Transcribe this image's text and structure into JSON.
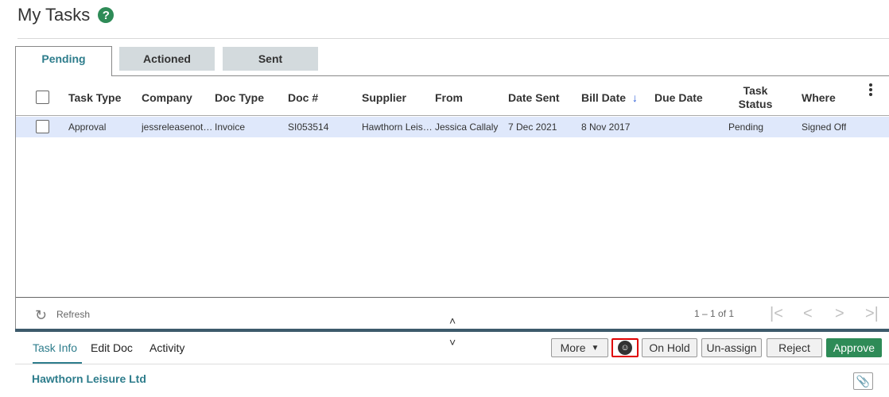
{
  "header": {
    "title": "My Tasks",
    "help_symbol": "?"
  },
  "tabs": [
    {
      "label": "Pending",
      "active": true
    },
    {
      "label": "Actioned",
      "active": false
    },
    {
      "label": "Sent",
      "active": false
    }
  ],
  "grid": {
    "columns": [
      "Task Type",
      "Company",
      "Doc Type",
      "Doc #",
      "Supplier",
      "From",
      "Date Sent",
      "Bill Date",
      "Due Date",
      "Task\nStatus",
      "Where"
    ],
    "sort_indicator": "↓",
    "rows": [
      {
        "task_type": "Approval",
        "company": "jessreleasenot…",
        "doc_type": "Invoice",
        "doc_no": "SI053514",
        "supplier": "Hawthorn Leis…",
        "from": "Jessica Callaly",
        "date_sent": "7 Dec 2021",
        "bill_date": "8 Nov 2017",
        "due_date": "",
        "task_status": "Pending",
        "where": "Signed Off"
      }
    ]
  },
  "footer": {
    "refresh_label": "Refresh",
    "range": "1 – 1 of 1"
  },
  "bottom_tabs": [
    "Task Info",
    "Edit Doc",
    "Activity"
  ],
  "actions": {
    "more": "More",
    "on_hold": "On Hold",
    "un_assign": "Un-assign",
    "reject": "Reject",
    "approve": "Approve"
  },
  "detail": {
    "supplier_name": "Hawthorn Leisure Ltd"
  },
  "colors": {
    "accent": "#2e7d8c",
    "approve": "#2e8b57",
    "highlight_border": "#e00000",
    "row_selected": "#dfe8fb"
  }
}
